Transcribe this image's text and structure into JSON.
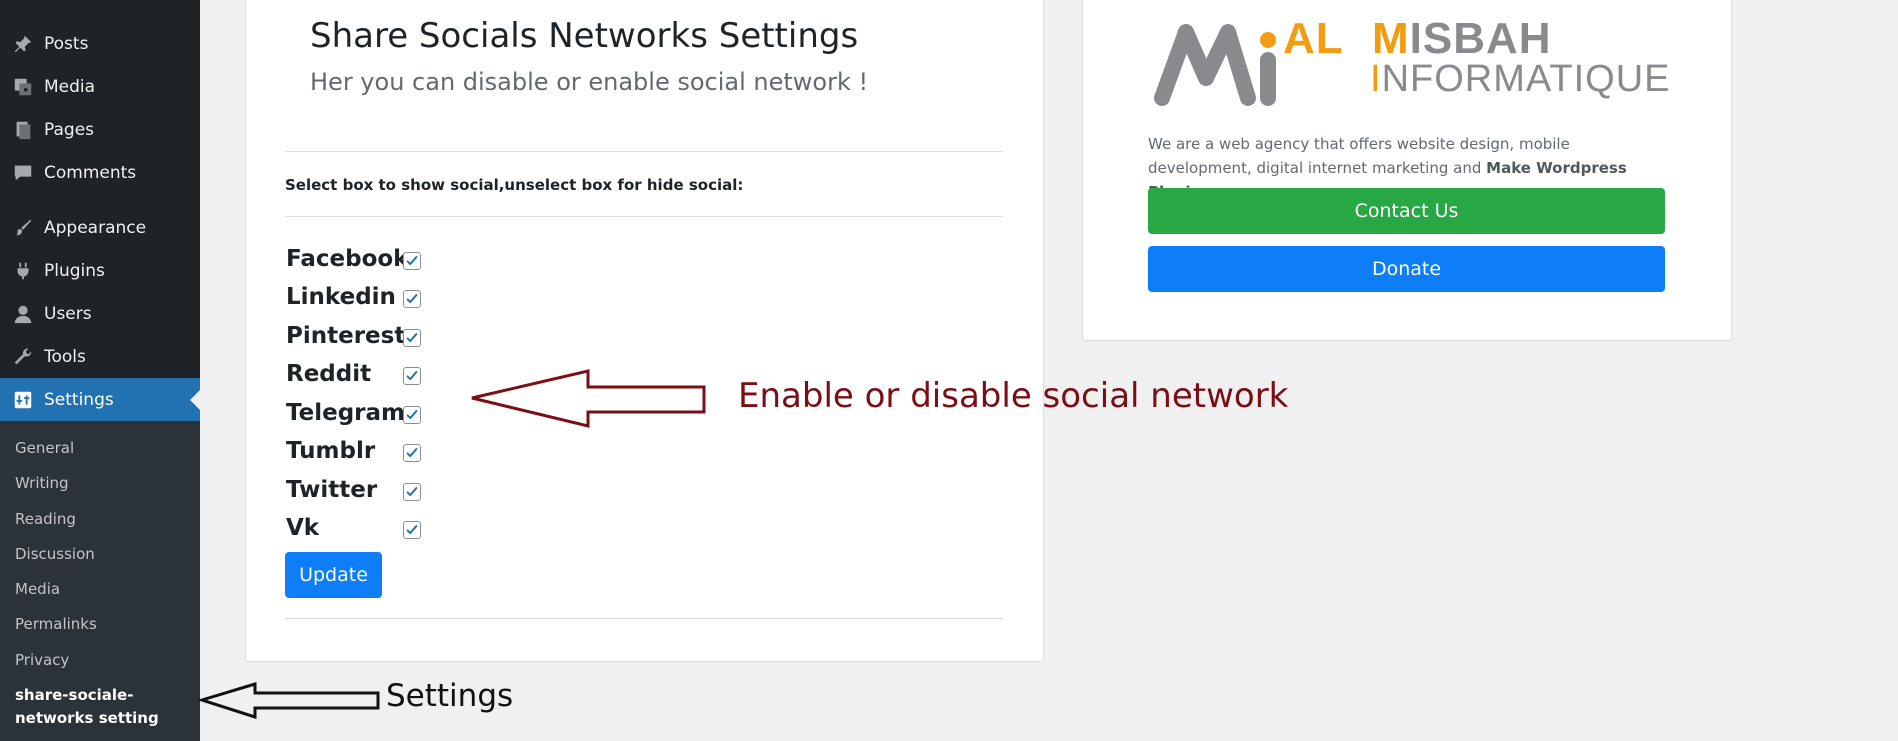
{
  "sidebar": {
    "menu": [
      {
        "label": "Posts",
        "icon": "pin-icon"
      },
      {
        "label": "Media",
        "icon": "media-icon"
      },
      {
        "label": "Pages",
        "icon": "pages-icon"
      },
      {
        "label": "Comments",
        "icon": "comments-icon"
      },
      {
        "label": "Appearance",
        "icon": "brush-icon"
      },
      {
        "label": "Plugins",
        "icon": "plug-icon"
      },
      {
        "label": "Users",
        "icon": "user-icon"
      },
      {
        "label": "Tools",
        "icon": "wrench-icon"
      },
      {
        "label": "Settings",
        "icon": "settings-icon"
      }
    ],
    "submenu": [
      "General",
      "Writing",
      "Reading",
      "Discussion",
      "Media",
      "Permalinks",
      "Privacy",
      "share-sociale-networks setting"
    ]
  },
  "main": {
    "title": "Share Socials Networks Settings",
    "subtitle": "Her you can disable or enable social network !",
    "instruction": "Select box to show social,unselect box for hide social:",
    "socials": [
      {
        "label": "Facebook",
        "checked": true
      },
      {
        "label": "Linkedin",
        "checked": true
      },
      {
        "label": "Pinterest",
        "checked": true
      },
      {
        "label": "Reddit",
        "checked": true
      },
      {
        "label": "Telegram",
        "checked": true
      },
      {
        "label": "Tumblr",
        "checked": true
      },
      {
        "label": "Twitter",
        "checked": true
      },
      {
        "label": "Vk",
        "checked": true
      }
    ],
    "update_label": "Update"
  },
  "promo": {
    "logo_word1": "AL",
    "logo_word2": "MISBAH",
    "logo_word3": "INFORMATIQUE",
    "desc_text": "We are a web agency that offers website design, mobile development, digital internet marketing and",
    "desc_bold": "Make Wordpress Plugins",
    "desc_end": ".",
    "contact_label": "Contact Us",
    "donate_label": "Donate"
  },
  "annotations": {
    "arrow1_text": "Enable or disable social network",
    "arrow2_text": "Settings"
  },
  "colors": {
    "sidebar_bg": "#1d2327",
    "submenu_bg": "#2c3338",
    "active_blue": "#2271b1",
    "contact_green": "#28a745",
    "donate_blue": "#0d7ef7",
    "logo_orange": "#f39c12",
    "logo_gray": "#888a8d",
    "annotation_red": "#7b0d14"
  }
}
